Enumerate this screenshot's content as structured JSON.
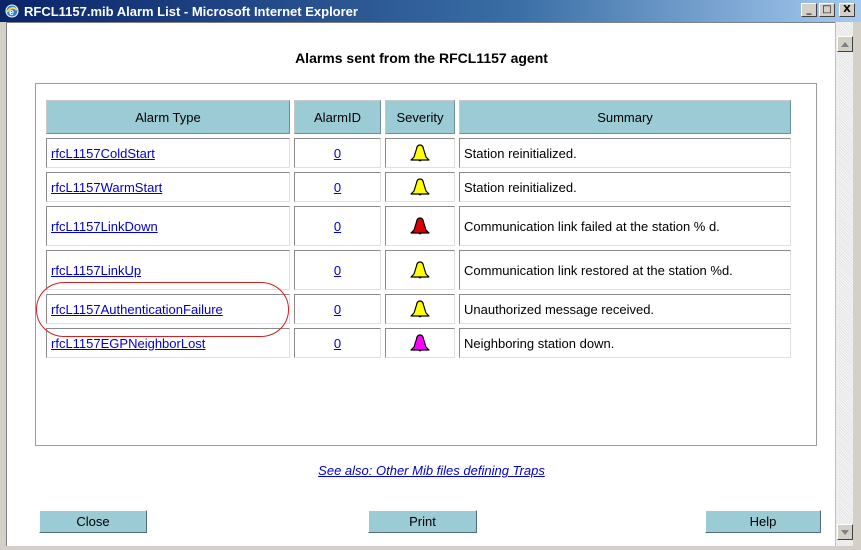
{
  "window": {
    "title": "RFCL1157.mib Alarm List - Microsoft Internet Explorer",
    "minimize_glyph": "_",
    "maximize_glyph": "□",
    "close_glyph": "X",
    "icon": "ie-icon"
  },
  "page": {
    "heading": "Alarms sent from the RFCL1157 agent"
  },
  "table": {
    "headers": {
      "type": "Alarm Type",
      "id": "AlarmID",
      "severity": "Severity",
      "summary": "Summary"
    },
    "rows": [
      {
        "type": "rfcL1157ColdStart",
        "id": "0",
        "severity_icon": "bell-yellow-icon",
        "severity_color": "#ffff00",
        "summary": "Station reinitialized."
      },
      {
        "type": "rfcL1157WarmStart",
        "id": "0",
        "severity_icon": "bell-yellow-icon",
        "severity_color": "#ffff00",
        "summary": "Station reinitialized."
      },
      {
        "type": "rfcL1157LinkDown",
        "id": "0",
        "severity_icon": "bell-red-icon",
        "severity_color": "#dd0000",
        "summary": "Communication link failed at the station % d."
      },
      {
        "type": "rfcL1157LinkUp",
        "id": "0",
        "severity_icon": "bell-yellow-icon",
        "severity_color": "#ffff00",
        "summary": "Communication link restored at the station %d."
      },
      {
        "type": "rfcL1157AuthenticationFailure",
        "id": "0",
        "severity_icon": "bell-yellow-icon",
        "severity_color": "#ffff00",
        "summary": "Unauthorized message received."
      },
      {
        "type": "rfcL1157EGPNeighborLost",
        "id": "0",
        "severity_icon": "bell-magenta-icon",
        "severity_color": "#ff00ff",
        "summary": "Neighboring station down."
      }
    ]
  },
  "links": {
    "see_also": "See also: Other Mib files defining Traps"
  },
  "buttons": {
    "close": "Close",
    "print": "Print",
    "help": "Help"
  },
  "colors": {
    "header_bg": "#9bcbd4",
    "button_bg": "#9bcbd4",
    "link": "#0000cc",
    "highlight_ring": "#d02020"
  }
}
